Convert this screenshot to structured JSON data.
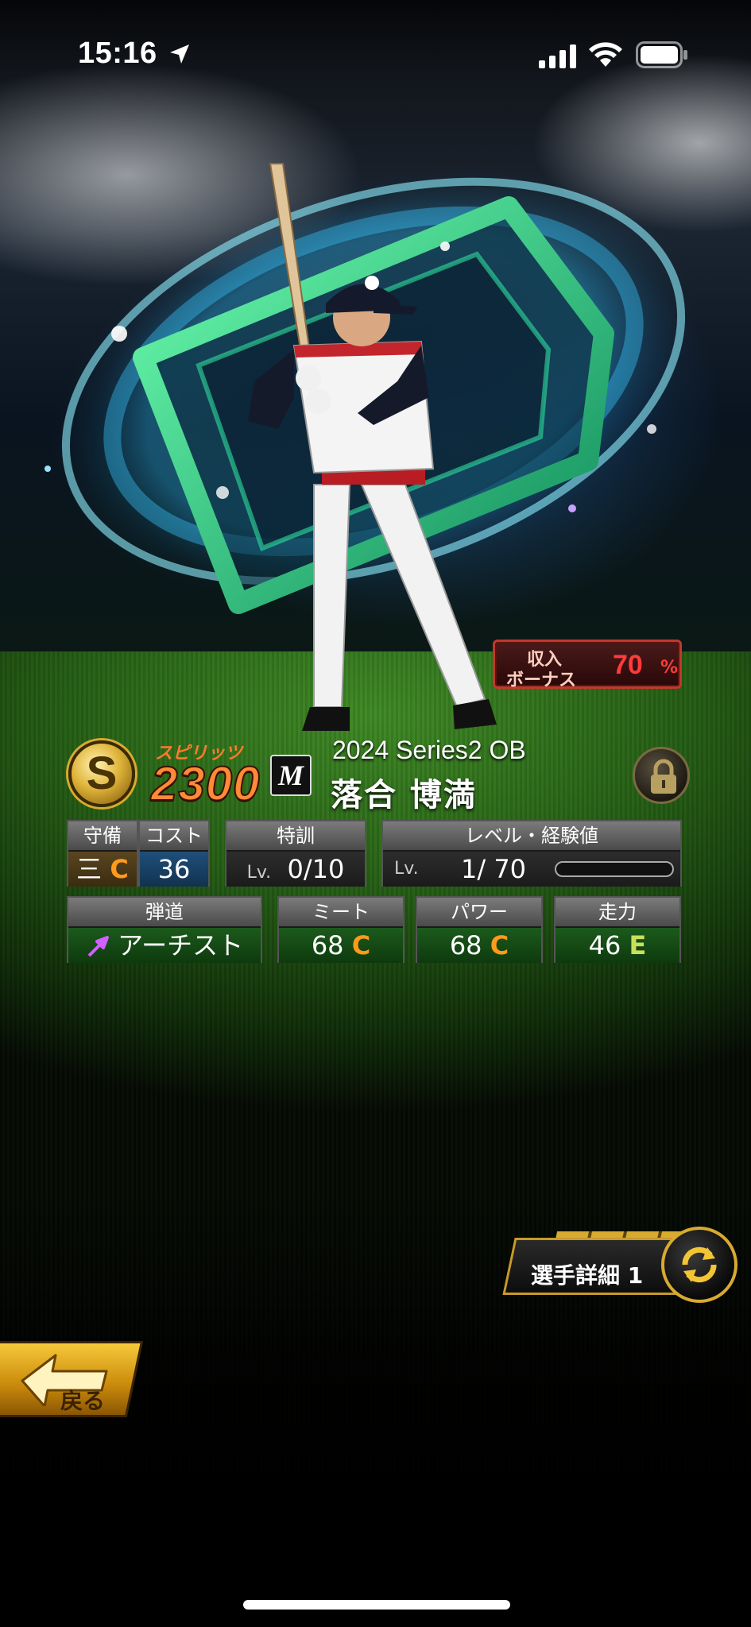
{
  "status_bar": {
    "time": "15:16",
    "icons": [
      "location-arrow-icon",
      "signal-icon",
      "wifi-icon",
      "battery-icon"
    ]
  },
  "bonus": {
    "label_line1": "収入",
    "label_line2": "ボーナス",
    "value": "70",
    "unit": "%"
  },
  "player": {
    "spirits_icon_letter": "S",
    "spirits_label": "スピリッツ",
    "spirits_value": "2300",
    "team_logo_letter": "M",
    "series": "2024 Series2 OB",
    "name": "落合 博満"
  },
  "stats_row1": {
    "position_header": "守備",
    "position_value": "三",
    "position_grade": "C",
    "cost_header": "コスト",
    "cost_value": "36",
    "training_header": "特訓",
    "training_prefix": "Lv.",
    "training_value": "0/10",
    "level_header": "レベル・経験値",
    "level_prefix": "Lv.",
    "level_value": "1/ 70",
    "exp_progress": 0
  },
  "stats_row2": {
    "trajectory_header": "弾道",
    "trajectory_value": "アーチスト",
    "meet_header": "ミート",
    "meet_value": "68",
    "meet_grade": "C",
    "power_header": "パワー",
    "power_value": "68",
    "power_grade": "C",
    "speed_header": "走力",
    "speed_value": "46",
    "speed_grade": "E"
  },
  "buttons": {
    "detail_label": "選手詳細 1",
    "back_label": "戻る"
  },
  "colors": {
    "accent_gold": "#d8aa30",
    "grade_c": "#ff9a1a",
    "grade_e": "#c8e05a",
    "bonus_red": "#ff3b3b"
  }
}
